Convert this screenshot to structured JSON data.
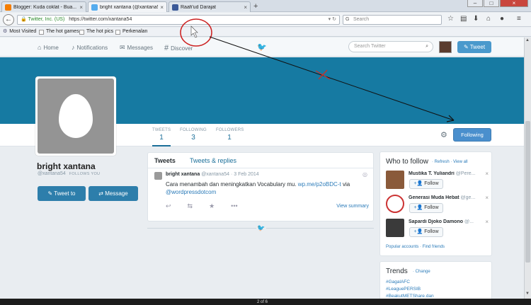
{
  "browser": {
    "tabs": [
      {
        "label": "Blogger: Kuda coklat - Bua...",
        "color": "#f57d00"
      },
      {
        "label": "bright xantana (@xantana5...",
        "color": "#55acee"
      },
      {
        "label": "Raafi'ud Darajat",
        "color": "#3b5998"
      }
    ],
    "new_tab": "+",
    "url_identity": "Twitter, Inc. (US)",
    "url": "https://twitter.com/xantana54",
    "search_placeholder": "Search",
    "bookmarks": [
      "Most Visited",
      "The hot games",
      "The hot pics",
      "Perkenalan"
    ]
  },
  "twitter_nav": {
    "items": [
      "Home",
      "Notifications",
      "Messages",
      "Discover"
    ],
    "search_placeholder": "Search Twitter",
    "tweet_button": "Tweet"
  },
  "profile": {
    "name": "bright xantana",
    "handle": "@xantana54",
    "follows_you": "FOLLOWS YOU",
    "tweet_to": "Tweet to",
    "message": "Message",
    "stats": [
      {
        "label": "TWEETS",
        "value": "1"
      },
      {
        "label": "FOLLOWING",
        "value": "3"
      },
      {
        "label": "FOLLOWERS",
        "value": "1"
      }
    ],
    "following_button": "Following",
    "banner_color": "#167aa2"
  },
  "timeline": {
    "tabs": [
      "Tweets",
      "Tweets & replies"
    ],
    "tweet": {
      "name": "bright xantana",
      "handle": "@xantana54",
      "date": "· 3 Feb 2014",
      "text": "Cara menambah dan meningkatkan Vocabulary mu.",
      "link1": "wp.me/p2oBDC-t",
      "via": "via",
      "link2": "@wordpressdotcom",
      "view_summary": "View summary"
    }
  },
  "who_to_follow": {
    "title": "Who to follow",
    "links": "· Refresh · View all",
    "suggestions": [
      {
        "name": "Mustika T. Yuliandri",
        "handle": "@Pere...",
        "follow": "Follow"
      },
      {
        "name": "Generasi Muda Hebat",
        "handle": "@ge...",
        "follow": "Follow"
      },
      {
        "name": "Sapardi Djoko Damono",
        "handle": "@...",
        "follow": "Follow"
      }
    ],
    "footer": "Popular accounts · Find friends"
  },
  "trends": {
    "title": "Trends",
    "change": "· Change",
    "items": [
      "#GagalAFC",
      "#LeaguePERSIB",
      "#BeakutMETShare.dan"
    ]
  },
  "footer": {
    "page": "2 of 6"
  }
}
